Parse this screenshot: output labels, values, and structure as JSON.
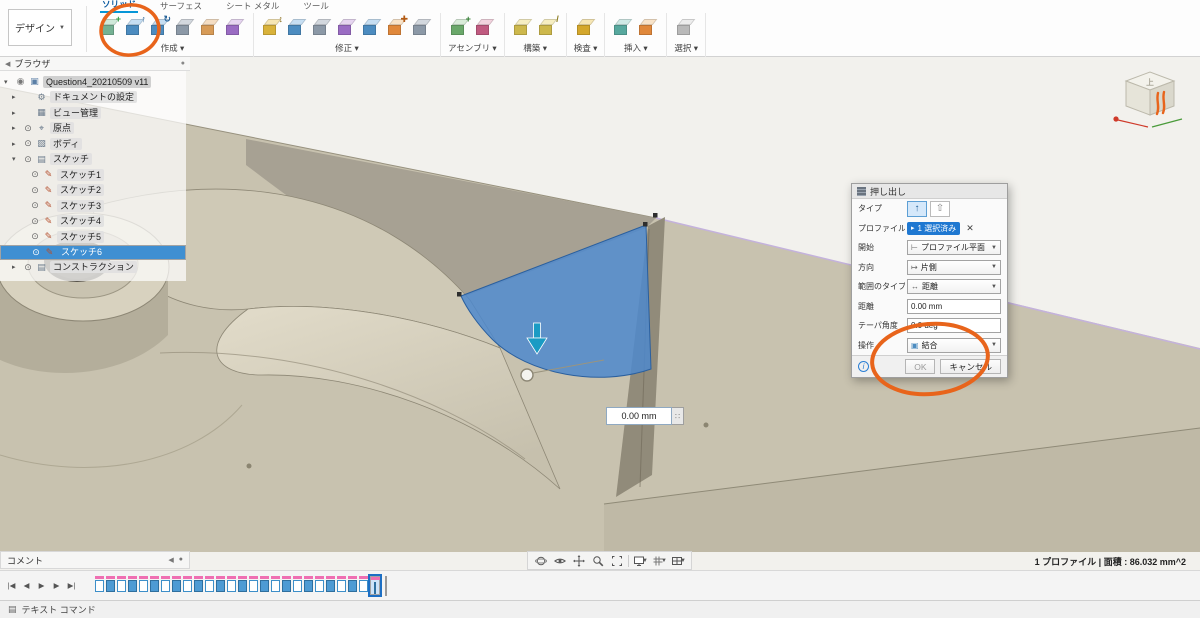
{
  "toolbar": {
    "design_button_label": "デザイン",
    "tabs": [
      {
        "key": "solid",
        "label": "ソリッド",
        "active": true
      },
      {
        "key": "surface",
        "label": "サーフェス",
        "active": false
      },
      {
        "key": "sheet-metal",
        "label": "シート メタル",
        "active": false
      },
      {
        "key": "tools",
        "label": "ツール",
        "active": false
      }
    ],
    "groups": [
      {
        "key": "create",
        "label": "作成",
        "icons": [
          {
            "name": "create-sketch-icon",
            "top": "#cfe9da",
            "front": "#75b193",
            "badge": "+",
            "badge_color": "#2f9e44"
          },
          {
            "name": "extrude-icon",
            "top": "#c6def2",
            "front": "#4c8cc0",
            "badge": "↑",
            "badge_color": "#1f5e96",
            "annotated": true
          },
          {
            "name": "revolve-icon",
            "top": "#c6def2",
            "front": "#4c8cc0",
            "badge": "↻",
            "badge_color": "#1f5e96"
          },
          {
            "name": "sweep-icon",
            "top": "#d3d8de",
            "front": "#8c99a7",
            "badge": "",
            "badge_color": ""
          },
          {
            "name": "box-primitive-icon",
            "top": "#f4ddc3",
            "front": "#d79b57",
            "badge": "",
            "badge_color": ""
          },
          {
            "name": "pattern-icon",
            "top": "#e6d5f0",
            "front": "#9a6cc3",
            "badge": "",
            "badge_color": ""
          }
        ]
      },
      {
        "key": "modify",
        "label": "修正",
        "icons": [
          {
            "name": "press-pull-icon",
            "top": "#f6e6b4",
            "front": "#d9b23a",
            "badge": "↕",
            "badge_color": "#8a6d1d"
          },
          {
            "name": "fillet-icon",
            "top": "#c6def2",
            "front": "#4c8cc0",
            "badge": "",
            "badge_color": ""
          },
          {
            "name": "shell-icon",
            "top": "#d3d8de",
            "front": "#8c99a7",
            "badge": "",
            "badge_color": ""
          },
          {
            "name": "combine-icon",
            "top": "#e6d5f0",
            "front": "#9a6cc3",
            "badge": "",
            "badge_color": ""
          },
          {
            "name": "offset-face-icon",
            "top": "#c6def2",
            "front": "#4c8cc0",
            "badge": "",
            "badge_color": ""
          },
          {
            "name": "move-copy-icon",
            "top": "#f8e3c9",
            "front": "#e0883b",
            "badge": "✚",
            "badge_color": "#b35b14"
          },
          {
            "name": "align-icon",
            "top": "#d3d8de",
            "front": "#8c99a7",
            "badge": "",
            "badge_color": ""
          }
        ]
      },
      {
        "key": "assemble",
        "label": "アセンブリ",
        "icons": [
          {
            "name": "new-component-icon",
            "top": "#d9ecd9",
            "front": "#6aa86a",
            "badge": "+",
            "badge_color": "#2f7d2f"
          },
          {
            "name": "joint-icon",
            "top": "#f2d3de",
            "front": "#c05a80",
            "badge": "",
            "badge_color": ""
          }
        ]
      },
      {
        "key": "construct",
        "label": "構築",
        "icons": [
          {
            "name": "offset-plane-icon",
            "top": "#f6eec2",
            "front": "#cdb84c",
            "badge": "",
            "badge_color": ""
          },
          {
            "name": "construction-axis-icon",
            "top": "#f6eec2",
            "front": "#cdb84c",
            "badge": "/",
            "badge_color": "#8a7a1d"
          }
        ]
      },
      {
        "key": "inspect",
        "label": "検査",
        "icons": [
          {
            "name": "measure-icon",
            "top": "#f6e6b4",
            "front": "#d4a72c",
            "badge": "",
            "badge_color": ""
          }
        ]
      },
      {
        "key": "insert",
        "label": "挿入",
        "icons": [
          {
            "name": "insert-canvas-icon",
            "top": "#cfe9e5",
            "front": "#57a89e",
            "badge": "",
            "badge_color": ""
          },
          {
            "name": "insert-svg-icon",
            "top": "#f8e3c9",
            "front": "#e0883b",
            "badge": "",
            "badge_color": ""
          }
        ]
      },
      {
        "key": "select",
        "label": "選択",
        "icons": [
          {
            "name": "select-icon",
            "top": "#ececec",
            "front": "#b9b9b9",
            "badge": "",
            "badge_color": ""
          }
        ]
      }
    ]
  },
  "browser": {
    "panel_title": "ブラウザ",
    "rows": [
      {
        "kind": "doc",
        "label": "Question4_20210509 v11"
      },
      {
        "kind": "node",
        "icon_name": "document-settings-gear-icon",
        "glyph": "⚙",
        "eye": false,
        "expanded": false,
        "label": "ドキュメントの設定"
      },
      {
        "kind": "node",
        "icon_name": "named-views-icon",
        "glyph": "▦",
        "eye": false,
        "expanded": false,
        "label": "ビュー管理"
      },
      {
        "kind": "node",
        "icon_name": "origin-icon",
        "glyph": "⌖",
        "eye": true,
        "expanded": false,
        "label": "原点"
      },
      {
        "kind": "node",
        "icon_name": "bodies-folder-icon",
        "glyph": "▧",
        "eye": true,
        "expanded": false,
        "label": "ボディ"
      },
      {
        "kind": "node",
        "icon_name": "sketches-folder-icon",
        "glyph": "▤",
        "eye": true,
        "expanded": true,
        "label": "スケッチ"
      },
      {
        "kind": "sketch",
        "label": "スケッチ1"
      },
      {
        "kind": "sketch",
        "label": "スケッチ2"
      },
      {
        "kind": "sketch",
        "label": "スケッチ3"
      },
      {
        "kind": "sketch",
        "label": "スケッチ4"
      },
      {
        "kind": "sketch",
        "label": "スケッチ5"
      },
      {
        "kind": "sketch",
        "label": "スケッチ6",
        "selected": true
      },
      {
        "kind": "node",
        "icon_name": "construction-folder-icon",
        "glyph": "▤",
        "eye": true,
        "expanded": false,
        "label": "コンストラクション"
      }
    ]
  },
  "viewport": {
    "dimension_value": "0.00 mm",
    "viewcube_top_label": "上"
  },
  "dialog": {
    "title": "押し出し",
    "type_label": "タイプ",
    "profile_label": "プロファイル",
    "profile_value": "1 選択済み",
    "start_label": "開始",
    "start_value": "プロファイル平面",
    "direction_label": "方向",
    "direction_value": "片側",
    "extent_label": "範囲のタイプ",
    "extent_value": "距離",
    "distance_label": "距離",
    "distance_value": "0.00 mm",
    "taper_label": "テーパ角度",
    "taper_value": "0.0 deg",
    "operation_label": "操作",
    "operation_value": "結合",
    "ok_label": "OK",
    "cancel_label": "キャンセル"
  },
  "navbar": {
    "icons": [
      {
        "name": "orbit-icon",
        "caret": false
      },
      {
        "name": "look-at-icon",
        "caret": false
      },
      {
        "name": "pan-icon",
        "caret": false
      },
      {
        "name": "zoom-icon",
        "caret": false
      },
      {
        "name": "fit-icon",
        "caret": false
      },
      {
        "name": "display-settings-icon",
        "caret": true
      },
      {
        "name": "grid-layout-icon",
        "caret": true
      },
      {
        "name": "viewports-icon",
        "caret": true
      }
    ]
  },
  "status_bar": {
    "text": "1 プロファイル | 面積 : 86.032 mm^2"
  },
  "comment_bar": {
    "label": "コメント"
  },
  "text_command_bar": {
    "label": "テキスト コマンド"
  },
  "timeline": {
    "controls": [
      {
        "name": "go-to-start-button",
        "glyph": "|◀"
      },
      {
        "name": "step-back-button",
        "glyph": "◀"
      },
      {
        "name": "play-button",
        "glyph": "▶"
      },
      {
        "name": "step-forward-button",
        "glyph": "▶"
      },
      {
        "name": "go-to-end-button",
        "glyph": "▶|"
      }
    ],
    "items": [
      {
        "type": "sketch"
      },
      {
        "type": "extrude"
      },
      {
        "type": "sketch"
      },
      {
        "type": "extrude"
      },
      {
        "type": "sketch"
      },
      {
        "type": "extrude"
      },
      {
        "type": "sketch"
      },
      {
        "type": "extrude"
      },
      {
        "type": "sketch"
      },
      {
        "type": "extrude"
      },
      {
        "type": "sketch"
      },
      {
        "type": "extrude"
      },
      {
        "type": "sketch"
      },
      {
        "type": "extrude"
      },
      {
        "type": "sketch"
      },
      {
        "type": "extrude"
      },
      {
        "type": "sketch"
      },
      {
        "type": "extrude"
      },
      {
        "type": "sketch"
      },
      {
        "type": "extrude"
      },
      {
        "type": "sketch"
      },
      {
        "type": "extrude"
      },
      {
        "type": "sketch"
      },
      {
        "type": "extrude"
      },
      {
        "type": "sketch"
      },
      {
        "type": "extrude",
        "selected": true
      }
    ]
  },
  "colors": {
    "accent_blue": "#0696d7",
    "selection_blue": "#3f8fd2",
    "profile_fill_blue": "#4d88cc",
    "annotation_orange": "#e8641b",
    "timeline_pink": "#ef6fb2",
    "model_tan": "#c8c2af"
  }
}
